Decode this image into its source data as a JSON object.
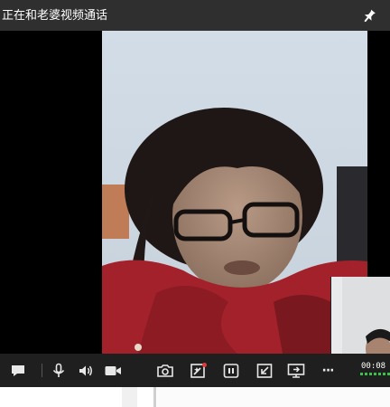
{
  "window": {
    "title": "正在和老婆视频通话",
    "pin_icon": "pin-icon"
  },
  "video": {
    "remote_feed": "remote-video",
    "self_feed": "self-preview"
  },
  "toolbar": {
    "icons": [
      "chat-icon",
      "microphone-icon",
      "speaker-icon",
      "camera-toggle-icon",
      "screenshot-icon",
      "effects-icon",
      "pause-icon",
      "minimize-icon",
      "screen-share-icon",
      "more-icon"
    ],
    "more_label": "···",
    "timer_text": "00:08",
    "signal_color": "#39c24a"
  }
}
